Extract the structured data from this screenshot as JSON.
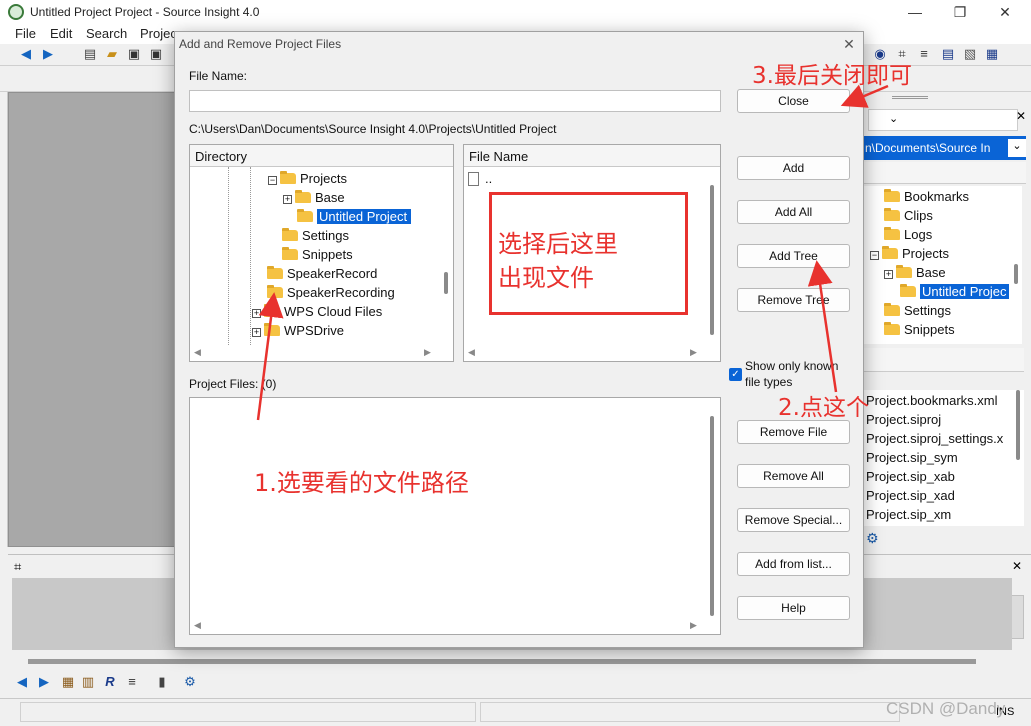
{
  "window": {
    "title": "Untitled Project Project - Source Insight 4.0",
    "controls": [
      "—",
      "❐",
      "✕"
    ]
  },
  "menu": [
    "File",
    "Edit",
    "Search",
    "Projec"
  ],
  "right_panel": {
    "path_combo": "n\\Documents\\Source In",
    "tree": [
      {
        "label": "Bookmarks"
      },
      {
        "label": "Clips"
      },
      {
        "label": "Logs"
      },
      {
        "label": "Projects",
        "expander": "⊟"
      },
      {
        "label": "Base",
        "expander": "⊞"
      },
      {
        "label": "Untitled Projec",
        "selected": true
      },
      {
        "label": "Settings"
      },
      {
        "label": "Snippets"
      }
    ],
    "files": [
      "Project.bookmarks.xml",
      "Project.siproj",
      "Project.siproj_settings.x",
      "Project.sip_sym",
      "Project.sip_xab",
      "Project.sip_xad",
      "Project.sip_xm"
    ]
  },
  "statusbar": {
    "ins": "INS"
  },
  "dialog": {
    "title": "Add and Remove Project Files",
    "file_name_label": "File Name:",
    "file_name_value": "",
    "current_path": "C:\\Users\\Dan\\Documents\\Source Insight 4.0\\Projects\\Untitled Project",
    "directory_header": "Directory",
    "directory_tree": [
      {
        "label": "Projects",
        "expander": "⊟"
      },
      {
        "label": "Base",
        "expander": "⊞"
      },
      {
        "label": "Untitled Project",
        "selected": true
      },
      {
        "label": "Settings"
      },
      {
        "label": "Snippets"
      },
      {
        "label": "SpeakerRecord"
      },
      {
        "label": "SpeakerRecording"
      },
      {
        "label": "WPS Cloud Files",
        "expander": "⊞"
      },
      {
        "label": "WPSDrive",
        "expander": "⊞"
      }
    ],
    "filename_header": "File Name",
    "file_list": [
      ".."
    ],
    "project_files_label": "Project Files: (0)",
    "show_known_label_1": "Show only known",
    "show_known_label_2": "file types",
    "show_known_checked": true,
    "buttons": {
      "close": "Close",
      "add": "Add",
      "add_all": "Add All",
      "add_tree": "Add Tree",
      "remove_tree": "Remove Tree",
      "remove_file": "Remove File",
      "remove_all": "Remove All",
      "remove_special": "Remove Special...",
      "add_from_list": "Add from list...",
      "help": "Help"
    }
  },
  "annotations": {
    "step1": "1.选要看的文件路径",
    "step2": "2.点这个",
    "step3": "3.最后关闭即可",
    "note_line1": "选择后这里",
    "note_line2": "出现文件",
    "color": "#e8322e"
  },
  "watermark": "CSDN @Dandy"
}
